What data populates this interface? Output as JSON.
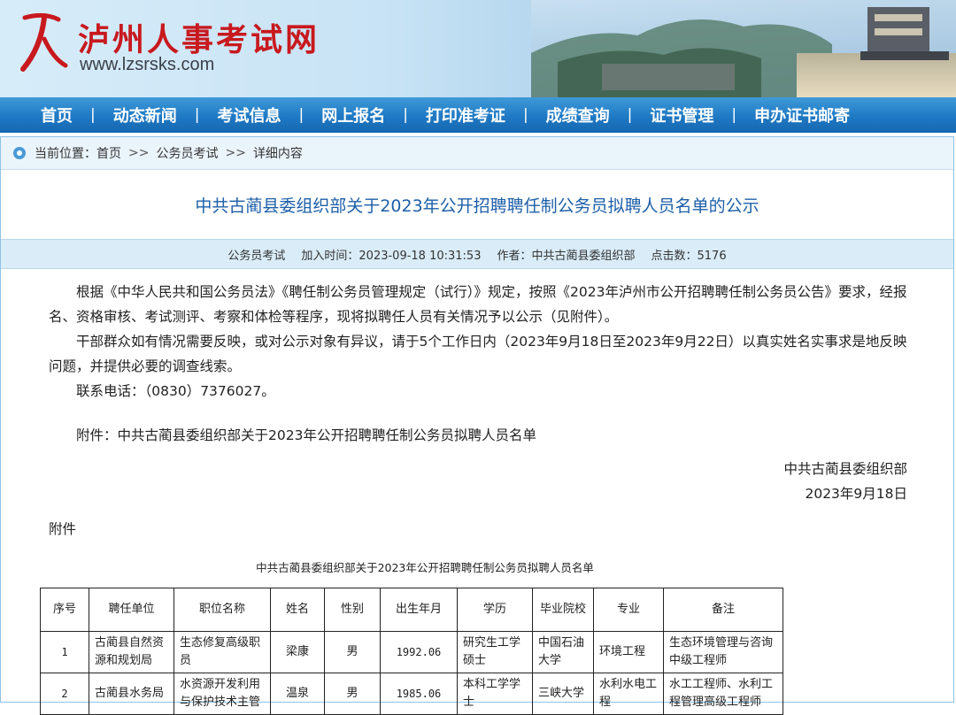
{
  "header": {
    "site_name": "泸州人事考试网",
    "site_url": "www.lzsrsks.com"
  },
  "nav": {
    "items": [
      "首页",
      "动态新闻",
      "考试信息",
      "网上报名",
      "打印准考证",
      "成绩查询",
      "证书管理",
      "申办证书邮寄"
    ],
    "separator": "|"
  },
  "breadcrumb": {
    "prefix": "当前位置：",
    "items": [
      "首页",
      "公务员考试",
      "详细内容"
    ],
    "separator": ">>"
  },
  "article": {
    "title": "中共古蔺县委组织部关于2023年公开招聘聘任制公务员拟聘人员名单的公示",
    "meta": {
      "category": "公务员考试",
      "added_time": "加入时间：2023-09-18 10:31:53",
      "author": "作者：中共古蔺县委组织部",
      "clicks": "点击数：5176"
    },
    "paragraphs": [
      "根据《中华人民共和国公务员法》《聘任制公务员管理规定（试行）》规定，按照《2023年泸州市公开招聘聘任制公务员公告》要求，经报名、资格审核、考试测评、考察和体检等程序，现将拟聘任人员有关情况予以公示（见附件）。",
      "干部群众如有情况需要反映，或对公示对象有异议，请于5个工作日内（2023年9月18日至2023年9月22日）以真实姓名实事求是地反映问题，并提供必要的调查线索。",
      "联系电话：（0830）7376027。"
    ],
    "attachment_line": "附件：中共古蔺县委组织部关于2023年公开招聘聘任制公务员拟聘人员名单",
    "sign_org": "中共古蔺县委组织部",
    "sign_date": "2023年9月18日",
    "attach_label": "附件",
    "table_title": "中共古蔺县委组织部关于2023年公开招聘聘任制公务员拟聘人员名单"
  },
  "table": {
    "headers": [
      "序号",
      "聘任单位",
      "职位名称",
      "姓名",
      "性别",
      "出生年月",
      "学历",
      "毕业院校",
      "专业",
      "备注"
    ],
    "rows": [
      [
        "1",
        "古蔺县自然资源和规划局",
        "生态修复高级职员",
        "梁康",
        "男",
        "1992.06",
        "研究生工学硕士",
        "中国石油大学",
        "环境工程",
        "生态环境管理与咨询中级工程师"
      ],
      [
        "2",
        "古蔺县水务局",
        "水资源开发利用与保护技术主管",
        "温泉",
        "男",
        "1985.06",
        "本科工学学士",
        "三峡大学",
        "水利水电工程",
        "水工工程师、水利工程管理高级工程师"
      ]
    ]
  },
  "colors": {
    "brand_red": "#c8191e",
    "nav_blue": "#1f79c4",
    "title_blue": "#1d5fa8",
    "meta_bg": "#d9ecf8"
  }
}
